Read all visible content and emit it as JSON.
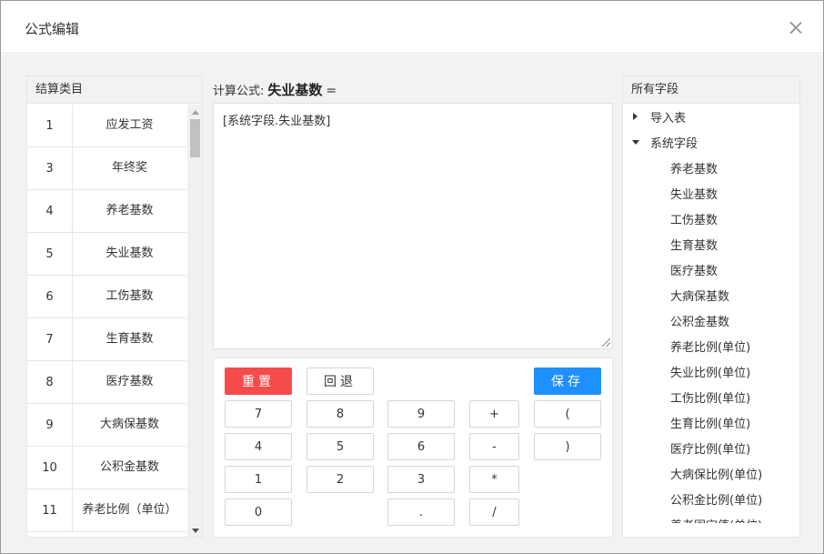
{
  "dialog": {
    "title": "公式编辑",
    "close_icon": "close-icon"
  },
  "categories": {
    "header": "结算类目",
    "rows": [
      {
        "num": "1",
        "name": "应发工资"
      },
      {
        "num": "3",
        "name": "年终奖"
      },
      {
        "num": "4",
        "name": "养老基数"
      },
      {
        "num": "5",
        "name": "失业基数"
      },
      {
        "num": "6",
        "name": "工伤基数"
      },
      {
        "num": "7",
        "name": "生育基数"
      },
      {
        "num": "8",
        "name": "医疗基数"
      },
      {
        "num": "9",
        "name": "大病保基数"
      },
      {
        "num": "10",
        "name": "公积金基数"
      },
      {
        "num": "11",
        "name": "养老比例（单位）"
      }
    ]
  },
  "formula": {
    "label": "计算公式:",
    "target": "失业基数",
    "equals": "=",
    "value": "[系统字段.失业基数]"
  },
  "keypad": {
    "reset": "重置",
    "back": "回退",
    "save": "保存",
    "keys": [
      "7",
      "8",
      "9",
      "+",
      "(",
      "4",
      "5",
      "6",
      "-",
      ")",
      "1",
      "2",
      "3",
      "*",
      "0",
      ".",
      "/"
    ]
  },
  "fields": {
    "header": "所有字段",
    "groups": [
      {
        "label": "导入表",
        "expanded": false,
        "items": []
      },
      {
        "label": "系统字段",
        "expanded": true,
        "items": [
          "养老基数",
          "失业基数",
          "工伤基数",
          "生育基数",
          "医疗基数",
          "大病保基数",
          "公积金基数",
          "养老比例(单位)",
          "失业比例(单位)",
          "工伤比例(单位)",
          "生育比例(单位)",
          "医疗比例(单位)",
          "大病保比例(单位)",
          "公积金比例(单位)",
          "养老固定值(单位)"
        ]
      }
    ]
  }
}
